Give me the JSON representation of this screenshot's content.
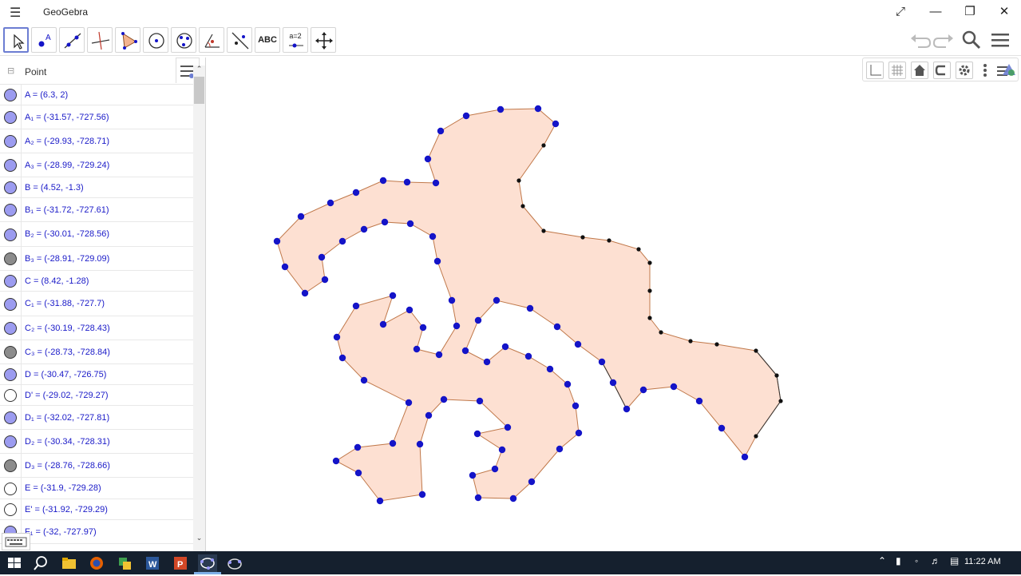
{
  "window": {
    "title": "GeoGebra"
  },
  "algebra": {
    "header_label": "Point",
    "rows": [
      {
        "text": "A = (6.3, 2)",
        "marker": "fill-blue"
      },
      {
        "text": "A₁ = (-31.57, -727.56)",
        "marker": "fill-blue"
      },
      {
        "text": "A₂ = (-29.93, -728.71)",
        "marker": "fill-blue"
      },
      {
        "text": "A₃ = (-28.99, -729.24)",
        "marker": "fill-blue"
      },
      {
        "text": "B = (4.52, -1.3)",
        "marker": "fill-blue"
      },
      {
        "text": "B₁ = (-31.72, -727.61)",
        "marker": "fill-blue"
      },
      {
        "text": "B₂ = (-30.01, -728.56)",
        "marker": "fill-blue"
      },
      {
        "text": "B₃ = (-28.91, -729.09)",
        "marker": "fill-gray"
      },
      {
        "text": "C = (8.42, -1.28)",
        "marker": "fill-blue"
      },
      {
        "text": "C₁ = (-31.88, -727.7)",
        "marker": "fill-blue"
      },
      {
        "text": "C₂ = (-30.19, -728.43)",
        "marker": "fill-blue"
      },
      {
        "text": "C₃ = (-28.73, -728.84)",
        "marker": "fill-gray"
      },
      {
        "text": "D = (-30.47, -726.75)",
        "marker": "fill-blue"
      },
      {
        "text": "D' = (-29.02, -729.27)",
        "marker": "hollow"
      },
      {
        "text": "D₁ = (-32.02, -727.81)",
        "marker": "fill-blue"
      },
      {
        "text": "D₂ = (-30.34, -728.31)",
        "marker": "fill-blue"
      },
      {
        "text": "D₃ = (-28.76, -728.66)",
        "marker": "fill-gray"
      },
      {
        "text": "E = (-31.9, -729.28)",
        "marker": "hollow"
      },
      {
        "text": "E' = (-31.92, -729.29)",
        "marker": "hollow"
      },
      {
        "text": "F₁ = (-32, -727.97)",
        "marker": "fill-blue"
      }
    ]
  },
  "toolbar": {
    "text_tool_label": "ABC",
    "slider_tool_label": "a=2"
  },
  "colors": {
    "point_blue": "#1414c8",
    "point_black": "#111111",
    "polygon_fill": "#fde0d2",
    "polygon_stroke": "#c0784a",
    "marker_blue": "#9c9cf0",
    "marker_gray": "#8c8c8c",
    "taskbar": "#15202e"
  },
  "icons": [
    "menu-icon",
    "expand-icon",
    "minimize-icon",
    "restore-icon",
    "close-icon",
    "undo-icon",
    "redo-icon",
    "search-icon",
    "hamburger-icon",
    "start-icon"
  ],
  "taskbar": {
    "time": "11:22 AM"
  }
}
